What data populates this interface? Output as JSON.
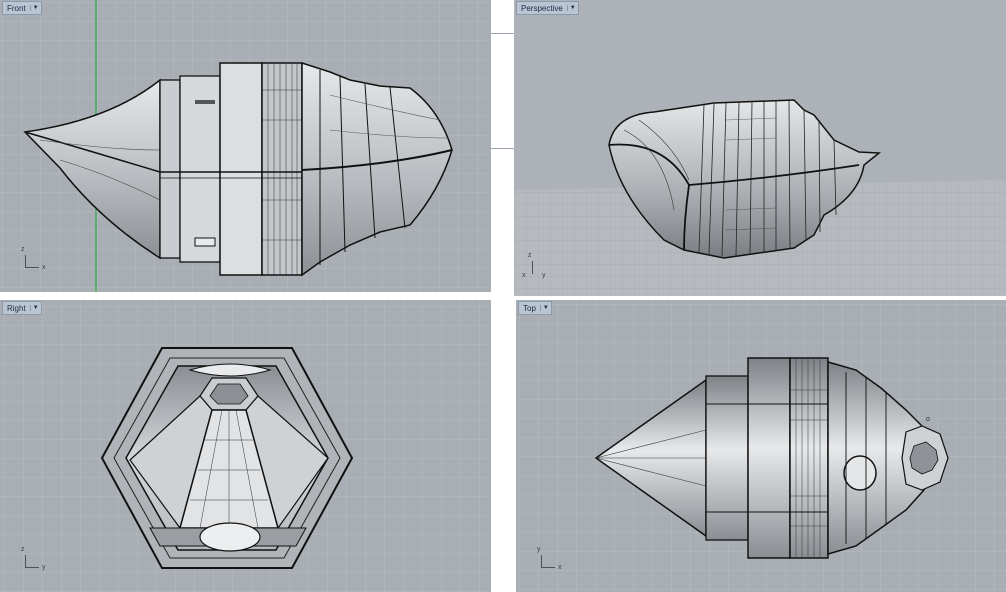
{
  "viewports": {
    "front": {
      "label": "Front",
      "axis_v": "z",
      "axis_h": "x"
    },
    "perspective": {
      "label": "Perspective",
      "axis_v": "z",
      "axis_h": "y",
      "axis_third": "x"
    },
    "right": {
      "label": "Right",
      "axis_v": "z",
      "axis_h": "y"
    },
    "top": {
      "label": "Top",
      "axis_v": "y",
      "axis_h": "x",
      "marker": "o"
    }
  },
  "colors": {
    "viewport_bg": "#a9aeb4",
    "grid_minor": "#b6bbc0",
    "grid_major": "#8e949a",
    "object_light": "#d9dcde",
    "object_shade": "#7d8186",
    "edge": "#111111",
    "label_bg": "#b9c5d3",
    "y_axis": "#2ea84a"
  },
  "icons": {
    "viewport_dropdown": "chevron-down-icon"
  }
}
